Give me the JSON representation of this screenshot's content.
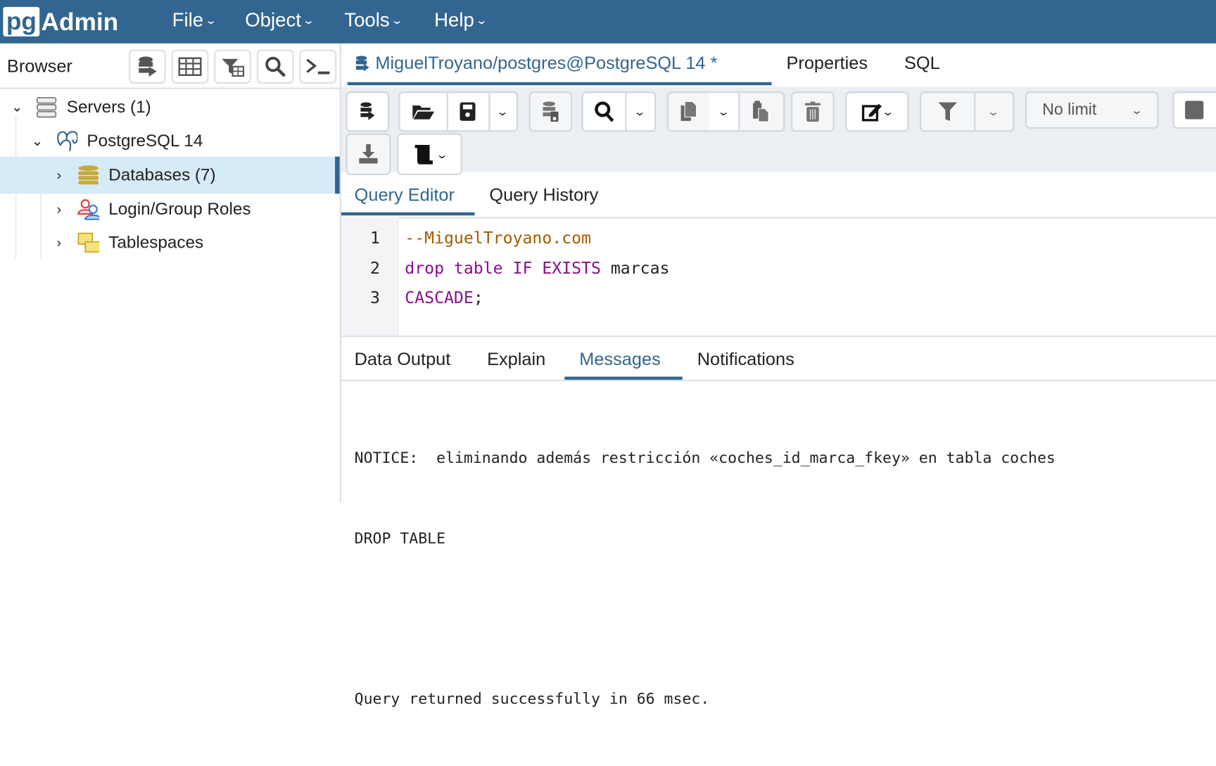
{
  "header": {
    "logo": "pgAdmin",
    "logo_pg": "pg",
    "logo_rest": "Admin",
    "menus": [
      "File",
      "Object",
      "Tools",
      "Help"
    ]
  },
  "browser": {
    "title": "Browser",
    "toolbar_icons": [
      "query-tool-icon",
      "table-icon",
      "filter-table-icon",
      "search-icon",
      "terminal-icon"
    ],
    "tree": [
      {
        "label": "Servers (1)",
        "expanded": true
      },
      {
        "label": "PostgreSQL 14",
        "expanded": true
      },
      {
        "label": "Databases (7)",
        "selected": true
      },
      {
        "label": "Login/Group Roles"
      },
      {
        "label": "Tablespaces"
      }
    ]
  },
  "tabs": {
    "items": [
      "MiguelTroyano/postgres@PostgreSQL 14 *",
      "Properties",
      "SQL"
    ],
    "active": 0
  },
  "toolbar": {
    "limit": "No limit"
  },
  "query_tabs": {
    "items": [
      "Query Editor",
      "Query History"
    ],
    "active": 0
  },
  "editor": {
    "line_numbers": [
      "1",
      "2",
      "3"
    ],
    "lines": [
      [
        {
          "t": "--MiguelTroyano.com",
          "c": "cm"
        }
      ],
      [
        {
          "t": "drop table IF EXISTS",
          "c": "kw"
        },
        {
          "t": " marcas",
          "c": ""
        }
      ],
      [
        {
          "t": "CASCADE",
          "c": "kw"
        },
        {
          "t": ";",
          "c": ""
        }
      ]
    ]
  },
  "result_tabs": {
    "items": [
      "Data Output",
      "Explain",
      "Messages",
      "Notifications"
    ],
    "active": 2
  },
  "messages": [
    "NOTICE:  eliminando además restricción «coches_id_marca_fkey» en tabla coches",
    "DROP TABLE",
    "",
    "Query returned successfully in 66 msec."
  ],
  "colors": {
    "brand": "#326690",
    "selected_row": "#d6ebf8",
    "comment": "#a55a00",
    "keyword": "#8a0e8a"
  }
}
